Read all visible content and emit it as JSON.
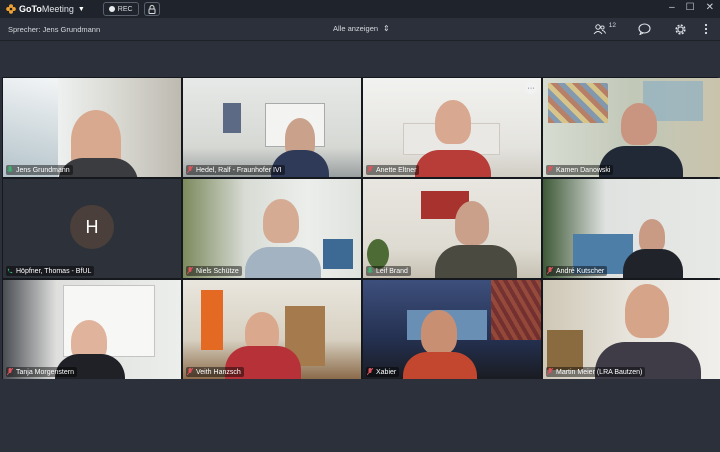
{
  "app": {
    "brand_a": "GoTo",
    "brand_b": "Meeting",
    "rec_label": "REC"
  },
  "toolbar": {
    "speaker": "Sprecher: Jens Grundmann",
    "view_all": "Alle anzeigen",
    "participant_count": "12"
  },
  "colors": {
    "accent": "#f0a233",
    "mic_muted": "#e0545c",
    "mic_active": "#3cb371"
  },
  "tiles": [
    {
      "name": "Jens Grundmann",
      "mic": "active"
    },
    {
      "name": "Hedel, Ralf - Fraunhofer IVI",
      "mic": "muted"
    },
    {
      "name": "Anette Eltner",
      "mic": "muted"
    },
    {
      "name": "Kamen Danowski",
      "mic": "muted"
    },
    {
      "name": "Höpfner, Thomas - BfUL",
      "mic": "phone",
      "initial": "H"
    },
    {
      "name": "Niels Schütze",
      "mic": "muted"
    },
    {
      "name": "Leif Brand",
      "mic": "active"
    },
    {
      "name": "André Kutscher",
      "mic": "muted"
    },
    {
      "name": "Tanja Morgenstern",
      "mic": "muted"
    },
    {
      "name": "Veith Hanzsch",
      "mic": "muted"
    },
    {
      "name": "Xabier",
      "mic": "muted"
    },
    {
      "name": "Martin Meier (LRA Bautzen)",
      "mic": "muted"
    }
  ],
  "more_button": "···"
}
